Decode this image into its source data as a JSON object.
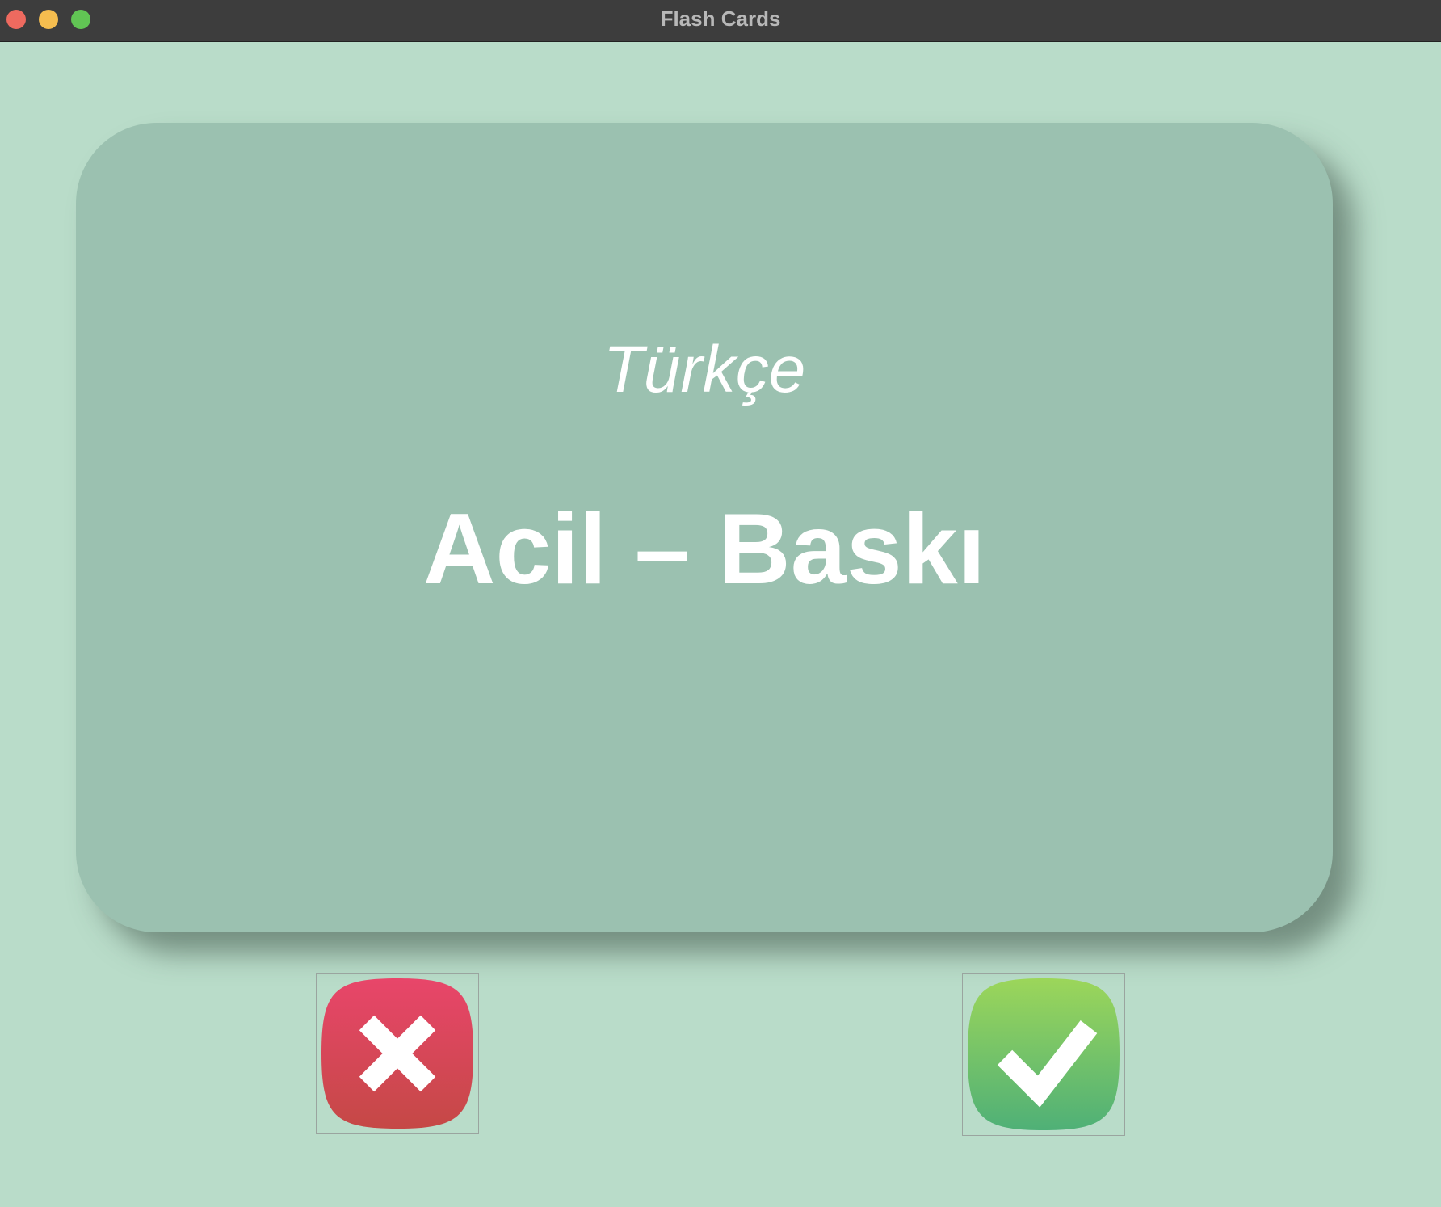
{
  "window": {
    "title": "Flash Cards"
  },
  "card": {
    "language": "Türkçe",
    "word": "Acil – Baskı"
  },
  "buttons": {
    "wrong_icon": "x-icon",
    "right_icon": "checkmark-icon"
  },
  "colors": {
    "background": "#b9dcc9",
    "card": "#9bc1b0",
    "wrong_top": "#e8466a",
    "wrong_bottom": "#c54846",
    "right_top": "#9cd65a",
    "right_bottom": "#4fb077"
  }
}
